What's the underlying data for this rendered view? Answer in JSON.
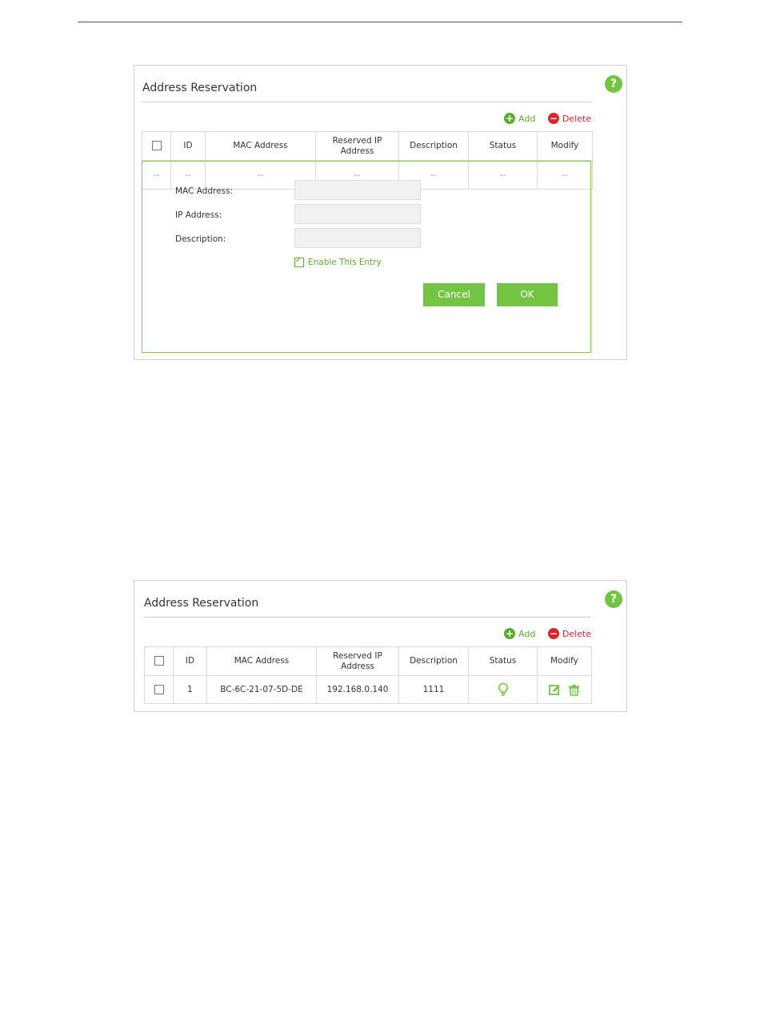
{
  "panel1": {
    "title": "Address Reservation",
    "help_label": "?",
    "add_label": "Add",
    "delete_label": "Delete",
    "columns": [
      "ID",
      "MAC Address",
      "Reserved IP Address",
      "Description",
      "Status",
      "Modify"
    ],
    "empty_row": [
      "--",
      "--",
      "--",
      "--",
      "--",
      "--",
      "--"
    ],
    "form": {
      "mac_label": "MAC Address:",
      "ip_label": "IP Address:",
      "description_label": "Description:",
      "mac_value": "",
      "ip_value": "",
      "description_value": "",
      "enable_label": "Enable This Entry",
      "enable_checked": true,
      "cancel_label": "Cancel",
      "ok_label": "OK"
    }
  },
  "panel2": {
    "title": "Address Reservation",
    "help_label": "?",
    "add_label": "Add",
    "delete_label": "Delete",
    "columns": [
      "ID",
      "MAC Address",
      "Reserved IP Address",
      "Description",
      "Status",
      "Modify"
    ],
    "rows": [
      {
        "id": "1",
        "mac": "BC-6C-21-07-5D-DE",
        "ip": "192.168.0.140",
        "description": "1111",
        "status_icon": "bulb-icon",
        "modify_icons": [
          "edit-icon",
          "trash-icon"
        ]
      }
    ]
  },
  "colors": {
    "accent_green": "#74c444",
    "delete_red": "#d9262c",
    "border": "#cfcfcf"
  }
}
